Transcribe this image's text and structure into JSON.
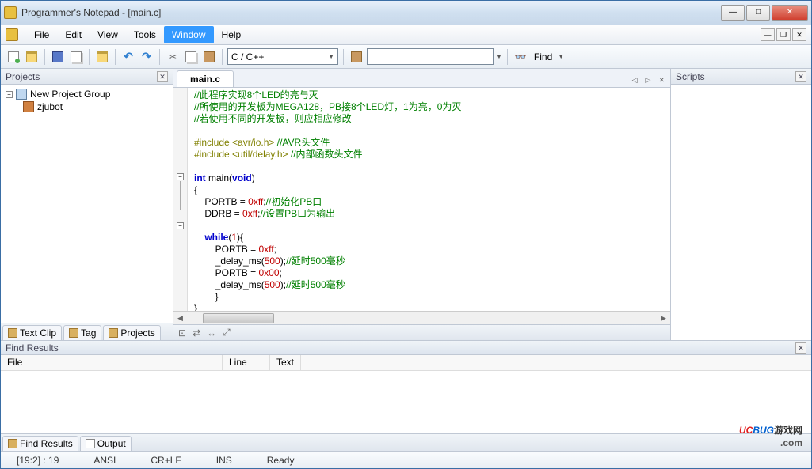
{
  "title": "Programmer's Notepad - [main.c]",
  "menu": {
    "file": "File",
    "edit": "Edit",
    "view": "View",
    "tools": "Tools",
    "window": "Window",
    "help": "Help"
  },
  "toolbar": {
    "lang_select": "C / C++",
    "find_label": "Find"
  },
  "panels": {
    "projects": {
      "title": "Projects",
      "root": "New Project Group",
      "child": "zjubot"
    },
    "scripts": {
      "title": "Scripts"
    },
    "left_tabs": {
      "textclips": "Text Clip",
      "tags": "Tag",
      "projects": "Projects"
    }
  },
  "editor": {
    "tab": "main.c",
    "code": {
      "c1": "//此程序实现8个LED的亮与灭",
      "c2": "//所使用的开发板为MEGA128，PB接8个LED灯，1为亮，0为灭",
      "c3": "//若使用不同的开发板，则应相应修改",
      "inc1a": "#include <avr/io.h> ",
      "inc1b": "//AVR头文件",
      "inc2a": "#include <util/delay.h> ",
      "inc2b": "//内部函数头文件",
      "kw_int": "int",
      "fn_main": " main(",
      "kw_void": "void",
      "fn_close": ")",
      "br_o": "{",
      "l1a": "    PORTB = ",
      "hex_ff1": "0xff",
      "l1b": ";",
      "l1c": "//初始化PB口",
      "l2a": "    DDRB = ",
      "hex_ff2": "0xff",
      "l2b": ";",
      "l2c": "//设置PB口为输出",
      "kw_while": "    while",
      "wh_b": "(",
      "num1": "1",
      "wh_c": "){",
      "l3a": "        PORTB = ",
      "hex_ff3": "0xff",
      "l3b": ";",
      "l4a": "        _delay_ms(",
      "num500a": "500",
      "l4b": ");",
      "l4c": "//延时500毫秒",
      "l5a": "        PORTB = ",
      "hex_00": "0x00",
      "l5b": ";",
      "l6a": "        _delay_ms(",
      "num500b": "500",
      "l6b": ");",
      "l6c": "//延时500毫秒",
      "br_ci": "        }",
      "br_c": "}"
    }
  },
  "find": {
    "title": "Find Results",
    "cols": {
      "file": "File",
      "line": "Line",
      "text": "Text"
    },
    "tabs": {
      "results": "Find Results",
      "output": "Output"
    }
  },
  "status": {
    "pos": "[19:2] : 19",
    "enc": "ANSI",
    "eol": "CR+LF",
    "ins": "INS",
    "ready": "Ready"
  },
  "watermark": {
    "brand_u": "UC",
    "brand_c": "BUG",
    "cn": "游戏网",
    "com": ".com"
  }
}
